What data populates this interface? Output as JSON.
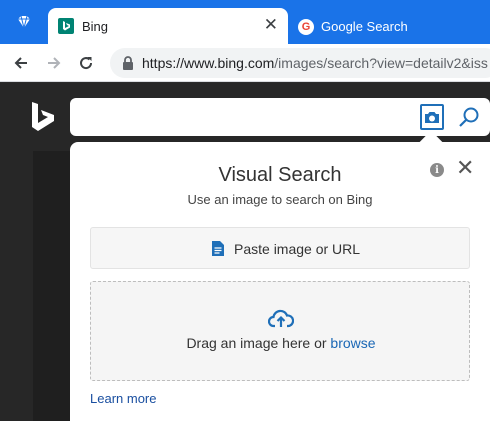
{
  "browser": {
    "tabs": [
      {
        "title": "Bing",
        "active": true,
        "favicon": "bing-favicon"
      },
      {
        "title": "Google Search",
        "active": false,
        "favicon": "google-favicon"
      }
    ],
    "tab_close": "✕",
    "url_domain": "https://www.bing.com",
    "url_path": "/images/search?view=detailv2&iss",
    "accent_color": "#1a73e8"
  },
  "visual_search": {
    "title": "Visual Search",
    "subtitle": "Use an image to search on Bing",
    "paste_label": "Paste image or URL",
    "drop_text": "Drag an image here or ",
    "browse_label": "browse",
    "learn_more": "Learn more",
    "close": "✕",
    "info": "i"
  },
  "colors": {
    "bing_dark": "#272727",
    "link_blue": "#1a67b5",
    "teal": "#008373"
  }
}
